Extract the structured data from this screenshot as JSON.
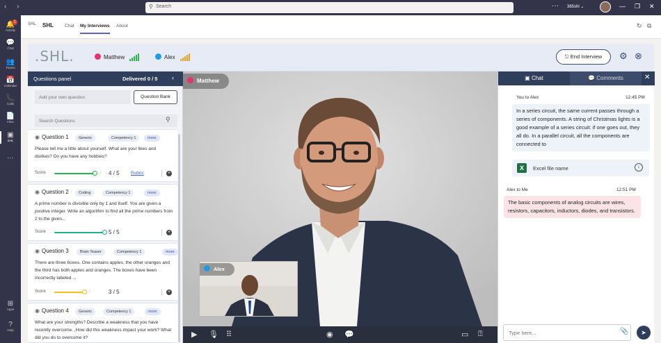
{
  "titlebar": {
    "search_placeholder": "Search",
    "org": "365shl ⌄",
    "more": "···"
  },
  "rail": [
    {
      "label": "Activity",
      "icon": "bell-icon",
      "glyph": "🔔",
      "badge": "1"
    },
    {
      "label": "Chat",
      "icon": "chat-icon",
      "glyph": "💬"
    },
    {
      "label": "Teams",
      "icon": "teams-icon",
      "glyph": "👥"
    },
    {
      "label": "Calendar",
      "icon": "calendar-icon",
      "glyph": "📅"
    },
    {
      "label": "Calls",
      "icon": "phone-icon",
      "glyph": "📞"
    },
    {
      "label": "Files",
      "icon": "file-icon",
      "glyph": "📄"
    },
    {
      "label": "SHL",
      "icon": "shl-app-icon",
      "glyph": "▣",
      "active": true
    },
    {
      "label": "",
      "icon": "more-icon",
      "glyph": "···"
    },
    {
      "label": "Apps",
      "icon": "apps-icon",
      "glyph": "⊞"
    },
    {
      "label": "Help",
      "icon": "help-icon",
      "glyph": "?"
    }
  ],
  "appbar": {
    "logo": "SHL",
    "app_name": "SHL",
    "tabs": [
      "Chat",
      "My Interviews",
      "About"
    ],
    "active_tab": 1
  },
  "interview": {
    "logo": ".SHL.",
    "participants": [
      {
        "name": "Matthew",
        "color": "#e5336d",
        "signal_color": "#2bb34c"
      },
      {
        "name": "Alex",
        "color": "#1e9be8",
        "signal_color": "#f0a020"
      }
    ],
    "end_label": "End Interview"
  },
  "questions_panel": {
    "title": "Questions panel",
    "delivered": "Delivered 0 / 5",
    "add_placeholder": "Add your own question",
    "bank_label": "Question Bank",
    "search_placeholder": "Search Questions",
    "score_label": "Score",
    "rubric_label": "Rubric",
    "questions": [
      {
        "title": "Question 1",
        "tags": [
          "Generic",
          "Competency 1",
          "more"
        ],
        "text": "Please tell me a little about yourself. What are your likes and dislikes? Do you have any hobbies?",
        "score": "4 / 5",
        "score_fraction": 0.8,
        "color": "#2bb34c",
        "rubric": true
      },
      {
        "title": "Question 2",
        "tags": [
          "Coding",
          "Competency 1",
          "more"
        ],
        "text": "A prime number is divisible only by 1 and itself. You are given a positive integer. Write an algorithm to find all the prime numbers from 2 to the given...",
        "score": "5 / 5",
        "score_fraction": 1.0,
        "color": "#1db28a",
        "rubric": false
      },
      {
        "title": "Question 3",
        "tags": [
          "Brain Teaser",
          "Competency 1",
          "more"
        ],
        "text": "There are three boxes. One contains apples, the other oranges and the third has both apples and oranges. The boxes have been incorrectly labeled ...",
        "score": "3 / 5",
        "score_fraction": 0.6,
        "color": "#f2c01c",
        "rubric": false
      },
      {
        "title": "Question 4",
        "tags": [
          "Generic",
          "Competency 1",
          "more"
        ],
        "text": "What are your strengths? Describe a weakness that you have recently overcome. ,How did this weakness impact your work? What did you do to overcome it?",
        "score": "",
        "score_fraction": null,
        "color": "#2bb34c",
        "rubric": false
      }
    ]
  },
  "video": {
    "main_name": "Matthew",
    "main_color": "#e5336d",
    "pip_name": "Alex",
    "pip_color": "#1e9be8"
  },
  "chat": {
    "tab_chat": "Chat",
    "tab_comments": "Comments",
    "messages": [
      {
        "from": "You to Alex",
        "time": "12:45 PM",
        "text": "In a series circuit, the same current passes through a series of components. A string of Christmas lights is a good example of a series circuit: if one goes out, they all do. In a parallel circuit, all the components are connected to"
      },
      {
        "from": "Alex to Me",
        "time": "12:51 PM",
        "text": "The basic components of analog circuits are wires, resistors, capacitors, inductors, diodes, and transistors."
      }
    ],
    "file_name": "Excel file name",
    "input_placeholder": "Type here..."
  },
  "colors": {
    "rail": "#33344a",
    "panel_header": "#2f3e5a",
    "accent": "#5b5fc7",
    "you_bubble": "#eef3fa",
    "them_bubble": "#fbe3e8"
  }
}
